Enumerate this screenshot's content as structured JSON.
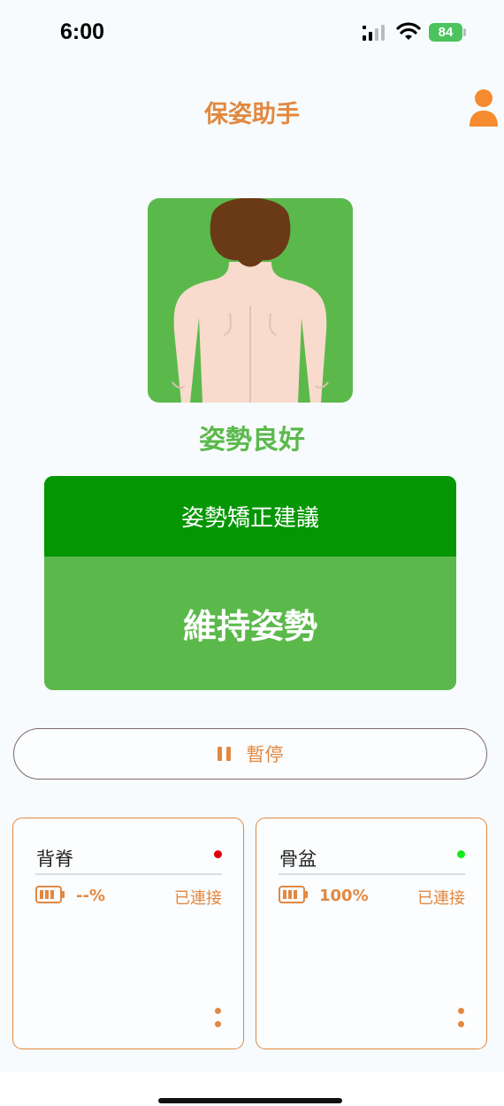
{
  "status_bar": {
    "time": "6:00",
    "battery_level": "84",
    "battery_color": "#4cc35c"
  },
  "header": {
    "title": "保姿助手",
    "profile_icon": "person-icon"
  },
  "posture": {
    "status_label": "姿勢良好",
    "status_color": "#5bb94b"
  },
  "advice": {
    "header": "姿勢矯正建議",
    "message": "維持姿勢"
  },
  "controls": {
    "pause_label": "暫停",
    "pause_icon": "pause-icon"
  },
  "sensors": [
    {
      "name": "背脊",
      "battery_text": "--%",
      "connection": "已連接",
      "status_dot_color": "#e0000a"
    },
    {
      "name": "骨盆",
      "battery_text": "100%",
      "connection": "已連接",
      "status_dot_color": "#18e818"
    }
  ],
  "colors": {
    "accent": "#e28840",
    "advice_header": "#049703",
    "good": "#5bb94b"
  }
}
